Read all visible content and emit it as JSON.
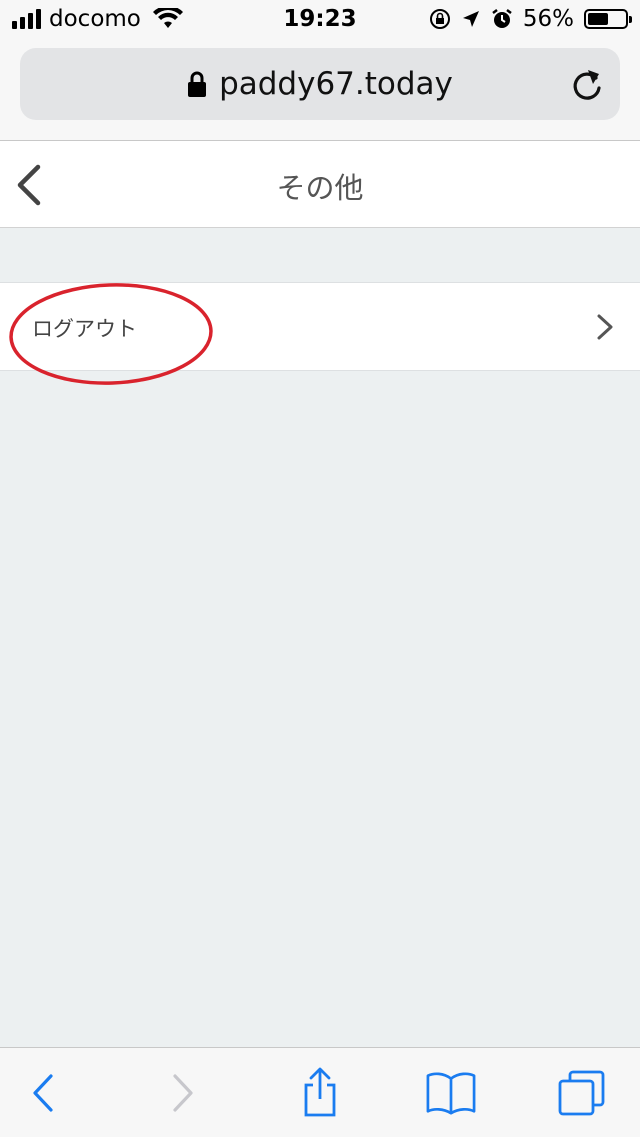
{
  "status_bar": {
    "carrier": "docomo",
    "time": "19:23",
    "battery_percent": "56%",
    "battery_level": 0.56
  },
  "browser": {
    "url": "paddy67.today"
  },
  "header": {
    "title": "その他"
  },
  "menu": {
    "items": [
      {
        "label": "ログアウト"
      }
    ]
  },
  "colors": {
    "accent": "#1a7cf0",
    "annotation": "#d9232d",
    "background": "#ecf0f1"
  },
  "icons": {
    "back": "chevron-left-icon",
    "reload": "reload-icon",
    "lock": "lock-icon",
    "share": "share-icon",
    "bookmarks": "book-icon",
    "tabs": "tabs-icon"
  }
}
